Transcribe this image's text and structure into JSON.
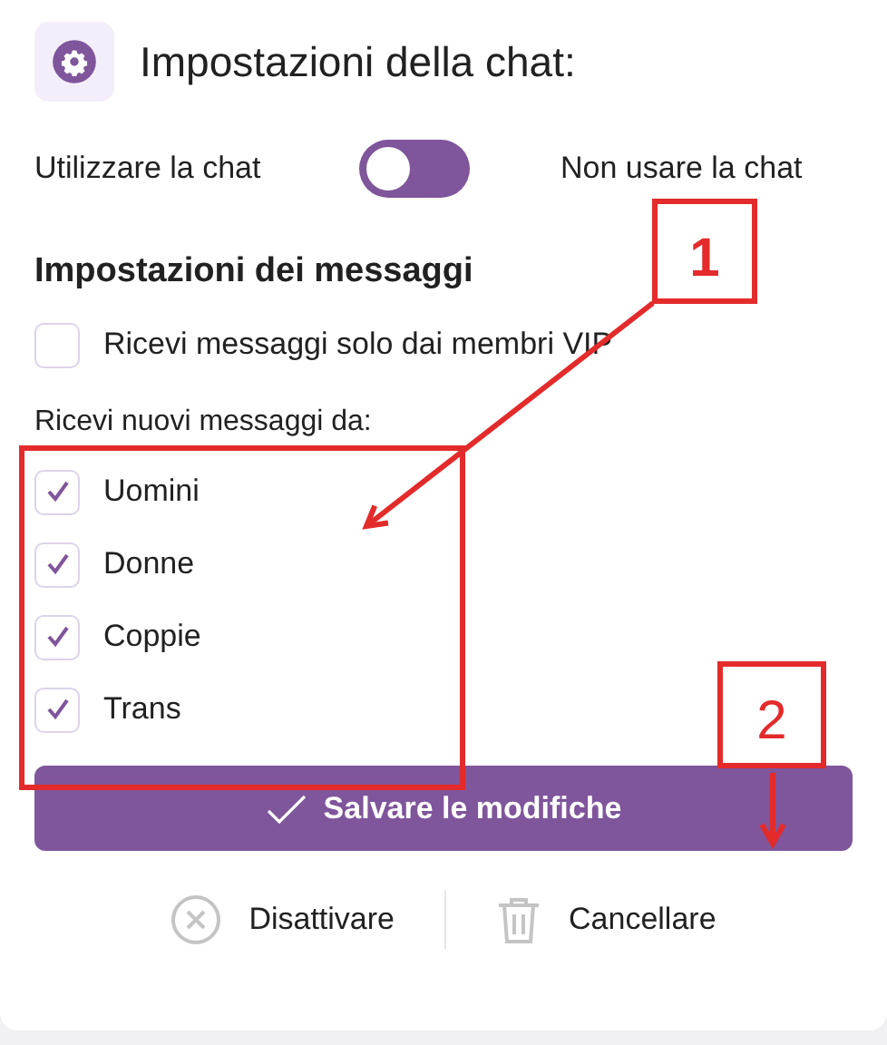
{
  "title": "Impostazioni della chat:",
  "toggle": {
    "label_left": "Utilizzare la chat",
    "label_right": "Non usare la chat",
    "on": false
  },
  "section_title": "Impostazioni dei messaggi",
  "vip_option": {
    "label": "Ricevi messaggi solo dai membri VIP",
    "checked": false
  },
  "receive_label": "Ricevi nuovi messaggi da:",
  "receive_options": [
    {
      "label": "Uomini",
      "checked": true
    },
    {
      "label": "Donne",
      "checked": true
    },
    {
      "label": "Coppie",
      "checked": true
    },
    {
      "label": "Trans",
      "checked": true
    }
  ],
  "save_button": "Salvare le modifiche",
  "actions": [
    {
      "kind": "deactivate",
      "label": "Disattivare"
    },
    {
      "kind": "delete",
      "label": "Cancellare"
    }
  ],
  "annotations": [
    {
      "label": "1"
    },
    {
      "label": "2"
    }
  ]
}
